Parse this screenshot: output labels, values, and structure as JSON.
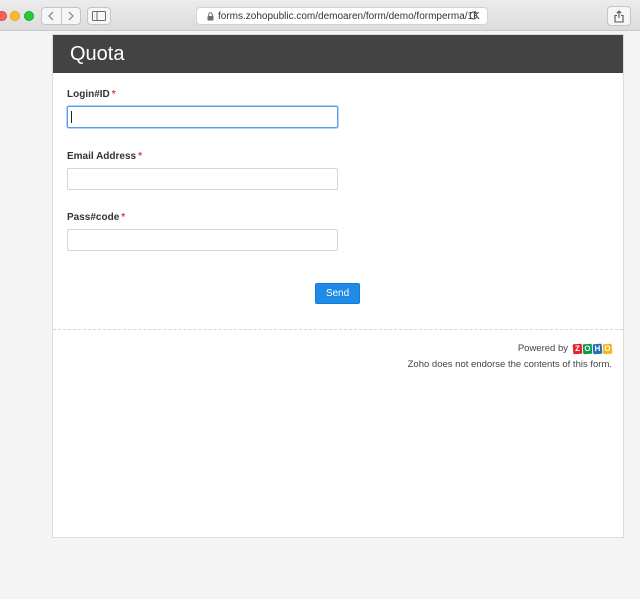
{
  "browser": {
    "url": "forms.zohopublic.com/demoaren/form/demo/formperma/1K"
  },
  "form": {
    "title": "Quota",
    "fields": [
      {
        "label": "Login#ID",
        "required_mark": "*",
        "value": ""
      },
      {
        "label": "Email Address",
        "required_mark": "*",
        "value": ""
      },
      {
        "label": "Pass#code",
        "required_mark": "*",
        "value": ""
      }
    ],
    "submit_label": "Send"
  },
  "footer": {
    "powered_by": "Powered by",
    "logo_letters": [
      "Z",
      "O",
      "H",
      "O"
    ],
    "logo_colors": [
      "#e42527",
      "#089949",
      "#226db4",
      "#f9b21d"
    ],
    "disclaimer": "Zoho does not endorse the contents of this form."
  },
  "colors": {
    "header_bg": "#434343",
    "accent": "#1e8be6",
    "required": "#e03a3a"
  }
}
